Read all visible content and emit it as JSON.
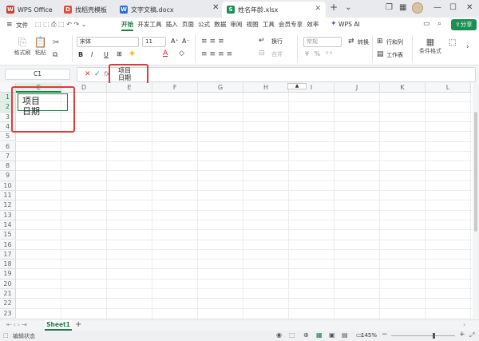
{
  "tabs": [
    {
      "label": "WPS Office",
      "icon": "wps-logo-icon",
      "color": "#d43b30"
    },
    {
      "label": "找稻壳模板",
      "icon": "docer-icon",
      "color": "#e04c3c"
    },
    {
      "label": "文字文稿.docx",
      "icon": "word-doc-icon",
      "color": "#2b6fd6"
    },
    {
      "label": "姓名年龄.xlsx",
      "icon": "spreadsheet-icon",
      "color": "#1b8f52"
    }
  ],
  "menu": {
    "file_label": "文件",
    "items": [
      "开始",
      "开发工具",
      "插入",
      "页面",
      "公式",
      "数据",
      "审阅",
      "视图",
      "工具",
      "会员专享",
      "效率"
    ],
    "active_index": 0,
    "wps_ai_label": "WPS AI",
    "share_label": "分享"
  },
  "ribbon": {
    "format_painter_label": "格式刷",
    "paste_label": "粘贴",
    "font_name": "宋体",
    "font_size": "11",
    "wrap_label": "换行",
    "merge_label": "合并",
    "number_format": "常规",
    "convert_label": "转换",
    "rows_cols_label": "行和列",
    "worksheet_label": "工作表",
    "conditional_label": "条件格式",
    "bold": "B",
    "italic": "I",
    "underline": "U"
  },
  "formula_bar": {
    "cell_ref": "C1",
    "fx_label": "fx",
    "line1": "项目",
    "line2": "日期"
  },
  "grid": {
    "columns": [
      "C",
      "D",
      "E",
      "F",
      "G",
      "H",
      "I",
      "J",
      "K",
      "L"
    ],
    "selected_column": "C",
    "rows": [
      "1",
      "2",
      "3",
      "4",
      "5",
      "6",
      "7",
      "8",
      "9",
      "10",
      "11",
      "12",
      "13",
      "14",
      "15",
      "16",
      "17",
      "18",
      "19",
      "20",
      "21",
      "22",
      "23"
    ],
    "cell_line1": "项目",
    "cell_line2": "日期"
  },
  "sheets": {
    "active": "Sheet1",
    "add_label": "+"
  },
  "status": {
    "mode": "编辑状态",
    "zoom": "145%"
  },
  "colors": {
    "accent": "#1b7d45",
    "highlight_box": "#e03b3b",
    "share_button": "#1b8f52"
  }
}
